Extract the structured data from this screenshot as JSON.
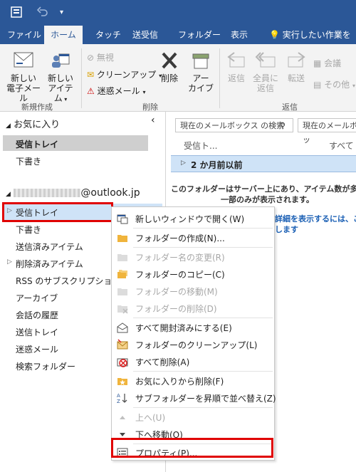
{
  "tabs": [
    "ファイル",
    "ホーム",
    "タッチ",
    "送受信",
    "フォルダー",
    "表示"
  ],
  "tell_me": "実行したい作業を入力",
  "ribbon": {
    "new_email": [
      "新しい",
      "電子メール"
    ],
    "new_items": [
      "新しい",
      "アイテム"
    ],
    "ignore": "無視",
    "cleanup": "クリーンアップ",
    "junk": "迷惑メール",
    "delete": "削除",
    "archive": [
      "アー",
      "カイブ"
    ],
    "reply": "返信",
    "reply_all": [
      "全員に",
      "返信"
    ],
    "forward": "転送",
    "meeting": "会議",
    "more": "その他",
    "group_new": "新規作成",
    "group_delete": "削除",
    "group_respond": "返信"
  },
  "folder_pane": {
    "favorites": "お気に入り",
    "fav_items": [
      "受信トレイ",
      "下書き"
    ],
    "account_suffix": "@outlook.jp",
    "folders": [
      "受信トレイ",
      "下書き",
      "送信済みアイテム",
      "削除済みアイテム",
      "RSS のサブスクリプション",
      "アーカイブ",
      "会話の履歴",
      "送信トレイ",
      "迷惑メール",
      "検索フォルダー"
    ]
  },
  "message_list": {
    "search1": "現在のメールボックス の検索",
    "search2": "現在のメールボッ",
    "col_from": "受信ト...",
    "col_all": "すべて",
    "group_header": "2 か月前以前",
    "notice_line1": "このフォルダーはサーバー上にあり、アイテム数が多いた",
    "notice_line2": "一部のみが表示されます。",
    "link_line1": "詳細を表示するには、こ",
    "link_line2": "します"
  },
  "context_menu": [
    {
      "label": "新しいウィンドウで開く(W)",
      "icon": "new-window-icon",
      "enabled": true
    },
    {
      "label": "フォルダーの作成(N)...",
      "icon": "folder-new-icon",
      "enabled": true
    },
    {
      "label": "フォルダー名の変更(R)",
      "icon": "folder-rename-icon",
      "enabled": false
    },
    {
      "label": "フォルダーのコピー(C)",
      "icon": "folder-copy-icon",
      "enabled": true
    },
    {
      "label": "フォルダーの移動(M)",
      "icon": "folder-move-icon",
      "enabled": false
    },
    {
      "label": "フォルダーの削除(D)",
      "icon": "folder-delete-icon",
      "enabled": false
    },
    {
      "label": "すべて開封済みにする(E)",
      "icon": "envelope-open-icon",
      "enabled": true
    },
    {
      "label": "フォルダーのクリーンアップ(L)",
      "icon": "cleanup-icon",
      "enabled": true
    },
    {
      "label": "すべて削除(A)",
      "icon": "delete-all-icon",
      "enabled": true
    },
    {
      "label": "お気に入りから削除(F)",
      "icon": "favorite-remove-icon",
      "enabled": true
    },
    {
      "label": "サブフォルダーを昇順で並べ替え(Z)",
      "icon": "sort-az-icon",
      "enabled": true
    },
    {
      "label": "上へ(U)",
      "icon": "arrow-up-icon",
      "enabled": false
    },
    {
      "label": "下へ移動(O)",
      "icon": "arrow-down-icon",
      "enabled": true
    },
    {
      "label": "プロパティ(P)...",
      "icon": "properties-icon",
      "enabled": true
    }
  ],
  "colors": {
    "brand": "#2b5797",
    "highlight_red": "#e00000",
    "selection_blue": "#cfe3f7"
  }
}
